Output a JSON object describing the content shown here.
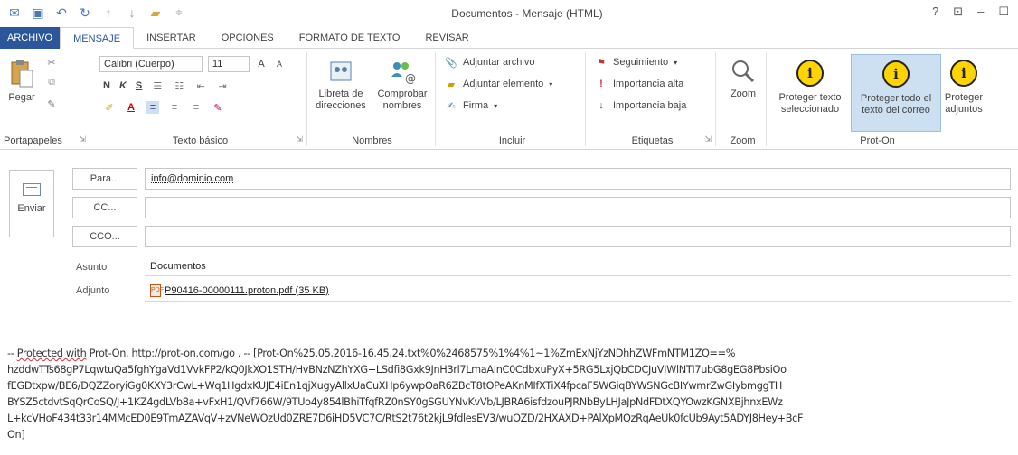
{
  "window": {
    "title": "Documentos - Mensaje (HTML)",
    "controls": [
      "?",
      "⊡",
      "–",
      "☐"
    ]
  },
  "tabs": [
    {
      "label": "ARCHIVO"
    },
    {
      "label": "MENSAJE"
    },
    {
      "label": "INSERTAR"
    },
    {
      "label": "OPCIONES"
    },
    {
      "label": "FORMATO DE TEXTO"
    },
    {
      "label": "REVISAR"
    }
  ],
  "ribbon": {
    "clipboard": {
      "paste": "Pegar",
      "label": "Portapapeles"
    },
    "basic_text": {
      "font": "Calibri (Cuerpo)",
      "size": "11",
      "bold": "N",
      "italic": "K",
      "underline": "S",
      "label": "Texto básico"
    },
    "names": {
      "address_book": "Libreta de direcciones",
      "check_names": "Comprobar nombres",
      "label": "Nombres"
    },
    "include": {
      "attach_file": "Adjuntar archivo",
      "attach_item": "Adjuntar elemento",
      "signature": "Firma",
      "label": "Incluir"
    },
    "tags": {
      "follow_up": "Seguimiento",
      "high_importance": "Importancia alta",
      "low_importance": "Importancia baja",
      "label": "Etiquetas"
    },
    "zoom": {
      "button": "Zoom",
      "label": "Zoom"
    },
    "prot_on": {
      "protect_selected": "Proteger texto seleccionado",
      "protect_all": "Proteger todo el texto del correo",
      "protect_attachments": "Proteger adjuntos",
      "label": "Prot-On"
    }
  },
  "compose": {
    "send": "Enviar",
    "to_button": "Para...",
    "to_value": "info@dominio.com",
    "cc_button": "CC...",
    "cc_value": "",
    "bcc_button": "CCO...",
    "bcc_value": "",
    "subject_label": "Asunto",
    "subject_value": "Documentos",
    "attachment_label": "Adjunto",
    "attachment_value": "P90416-00000111.proton.pdf (35 KB)"
  },
  "body": {
    "line1_pre": "-- ",
    "line1_mark": "Protected with",
    "line1_rest": " Prot-On. http://prot-on.com/go . -- [Prot-On%25.05.2016-16.45.24.txt%0%2468575%1%4%1~1%ZmExNjYzNDhhZWFmNTM1ZQ==%",
    "line2": "hzddwTTs68gP7LqwtuQa5fghYgaVd1VvkFP2/kQ0JkXO1STH/HvBNzNZhYXG+LSdfi8Gxk9JnH3rl7LmaAInC0CdbxuPyX+5RG5LxjQbCDCJuVIWlNTI7ubG8gEG8PbsiOo",
    "line3": "fEGDtxpw/BE6/DQZZoryiGg0KXY3rCwL+Wq1HgdxKUJE4iEn1qjXugyAllxUaCuXHp6ywpOaR6ZBcT8tOPeAKnMIfXTiX4fpcaF5WGiqBYWSNGcBIYwmrZwGIybmggTH",
    "line4": "BYSZ5ctdvtSqQrCoSQ/J+1KZ4gdLVb8a+vFxH1/QVf766W/9TUo4y854lBhiTfqfRZ0nSY0gSGUYNvKvVb/LJBRA6isfdzouPJRNbByLHJaJpNdFDtXQYOwzKGNXBjhnxEWz",
    "line5": "L+kcVHoF434t33r14MMcED0E9TmAZAVqV+zVNeWOzUd0ZRE7D6iHD5VC7C/RtS2t76t2kjL9fdlesEV3/wuOZD/2HXAXD+PAlXpMQzRqAeUk0fcUb9Ayt5ADYJ8Hey+BcF",
    "line6": "On]"
  }
}
